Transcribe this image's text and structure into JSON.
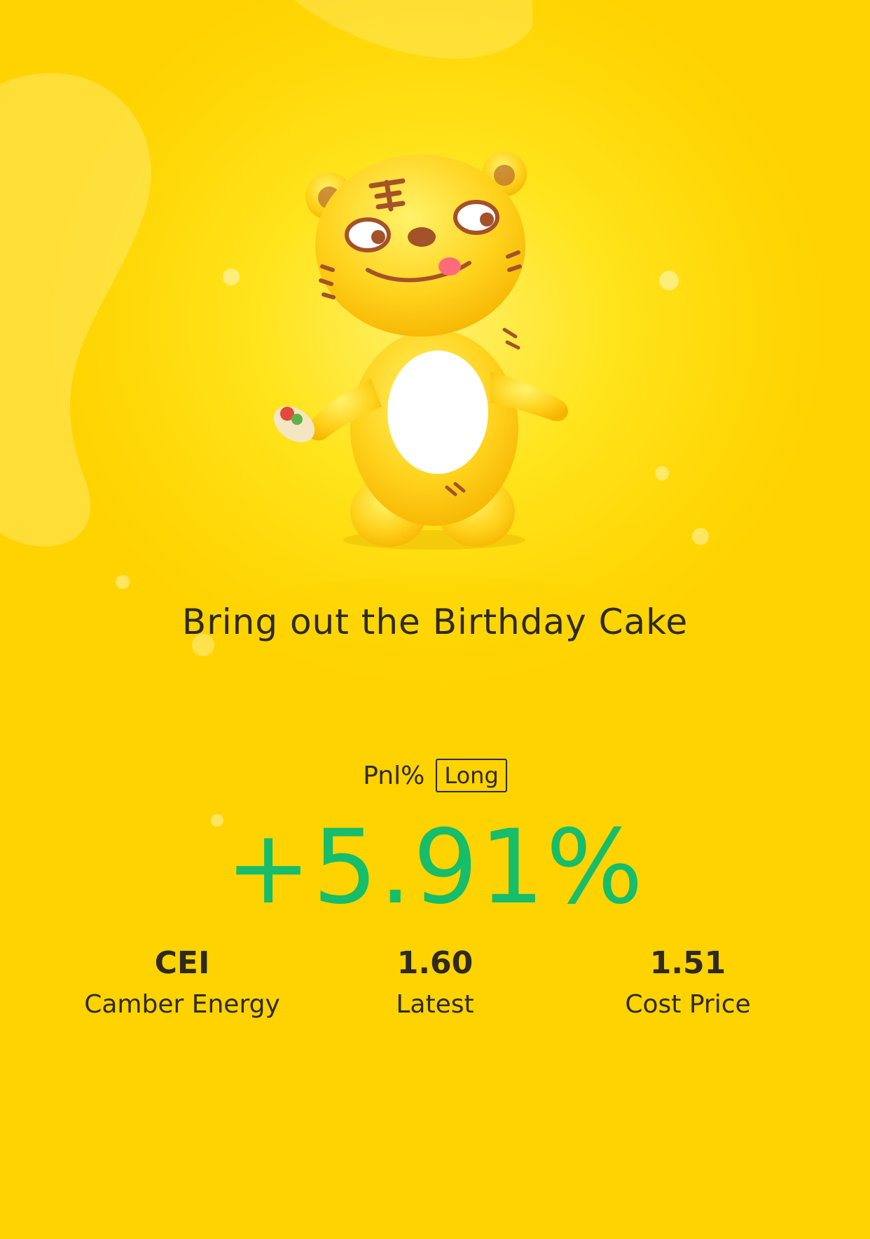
{
  "card": {
    "title": "Bring out the Birthday Cake",
    "pnl_label": "Pnl%",
    "position_tag": "Long",
    "pnl_value": "+5.91%",
    "colors": {
      "background": "#ffd90a",
      "accent_positive": "#16bd6a",
      "text": "#2e2a1f"
    }
  },
  "mascot": {
    "icon": "tiger-mascot-icon"
  },
  "stats": [
    {
      "value": "CEI",
      "label": "Camber Energy"
    },
    {
      "value": "1.60",
      "label": "Latest"
    },
    {
      "value": "1.51",
      "label": "Cost Price"
    }
  ]
}
